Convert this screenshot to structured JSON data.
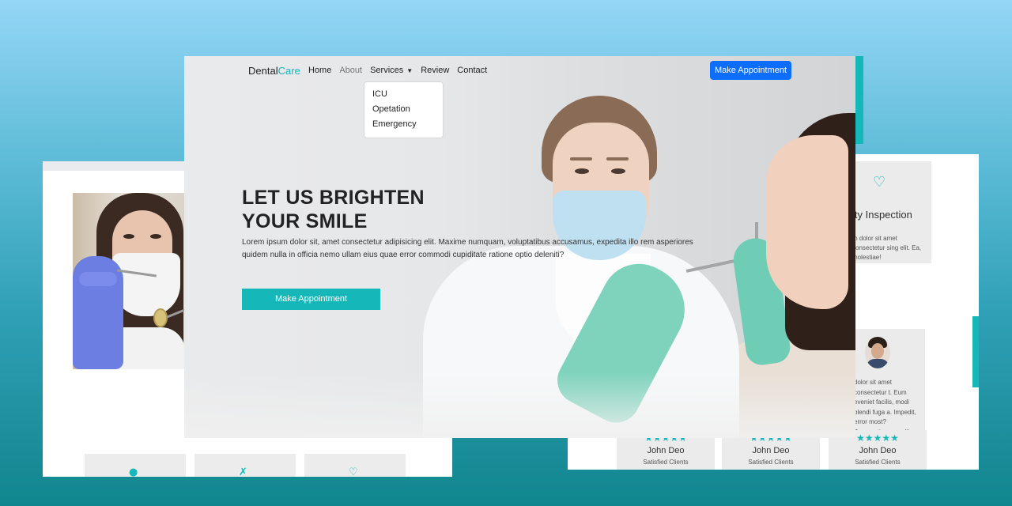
{
  "main": {
    "brand_prefix": "Dental",
    "brand_accent": "Care",
    "nav": {
      "home": "Home",
      "about": "About",
      "services": "Services",
      "review": "Review",
      "contact": "Contact"
    },
    "services_dropdown": [
      "ICU",
      "Opetation",
      "Emergency"
    ],
    "top_button": "Make Appointment",
    "hero_title_line1": "LET US BRIGHTEN",
    "hero_title_line2": "YOUR SMILE",
    "hero_text": "Lorem ipsum dolor sit, amet consectetur adipisicing elit. Maxime numquam, voluptatibus accusamus, expedita illo rem asperiores quidem nulla in officia nemo ullam eius quae error commodi cupiditate ratione optio deleniti?",
    "hero_button": "Make Appointment"
  },
  "right_card": {
    "service_title": "ity Inspection",
    "service_desc": "m dolor sit amet consectetur sing elit. Ea, molestiae!",
    "testimonial_text": "dolor sit amet consectetur t. Eum eveniet facilis, modi blendi fuga a. Impedit, error most? Praesentium ex e libero odio nam.",
    "reviews": [
      {
        "stars": "★★★★★",
        "name": "John Deo",
        "role": "Satisfied Clients"
      },
      {
        "stars": "★★★★★",
        "name": "John Deo",
        "role": "Satisfied Clients"
      },
      {
        "stars": "★★★★★",
        "name": "John Deo",
        "role": "Satisfied Clients"
      }
    ]
  },
  "colors": {
    "accent": "#16b7b9",
    "primary_button": "#0d6efd"
  }
}
